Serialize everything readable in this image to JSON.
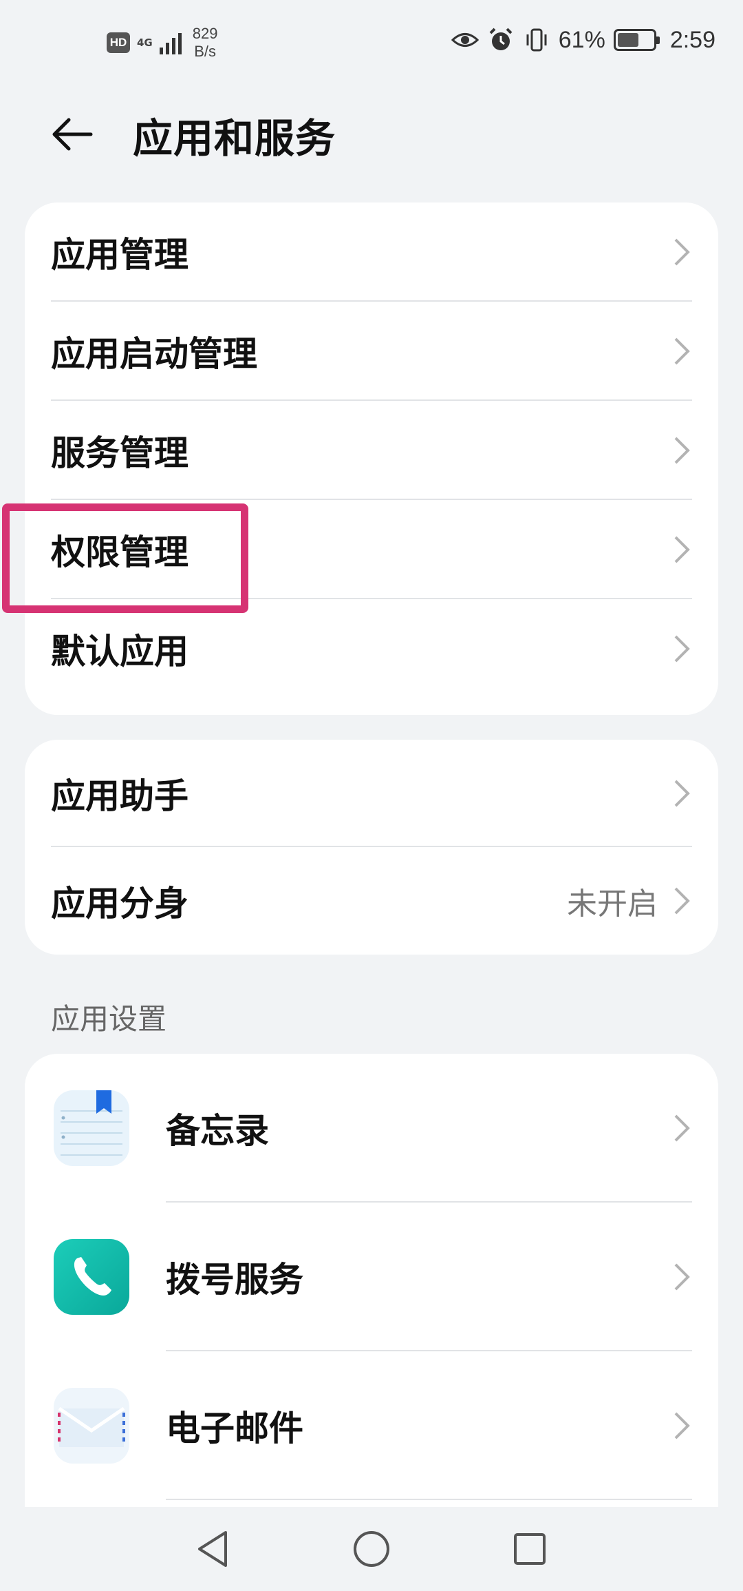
{
  "status_bar": {
    "hd": "HD",
    "network": "4G",
    "speed_value": "829",
    "speed_unit": "B/s",
    "battery": "61%",
    "time": "2:59",
    "battery_level": 0.61
  },
  "header": {
    "title": "应用和服务",
    "back_icon": "arrow-left-icon"
  },
  "group1": {
    "items": [
      {
        "label": "应用管理"
      },
      {
        "label": "应用启动管理"
      },
      {
        "label": "服务管理"
      },
      {
        "label": "权限管理"
      },
      {
        "label": "默认应用"
      }
    ]
  },
  "group2": {
    "items": [
      {
        "label": "应用助手",
        "value": ""
      },
      {
        "label": "应用分身",
        "value": "未开启"
      }
    ]
  },
  "app_settings": {
    "section_title": "应用设置",
    "items": [
      {
        "label": "备忘录",
        "icon": "notepad-icon"
      },
      {
        "label": "拨号服务",
        "icon": "phone-icon"
      },
      {
        "label": "电子邮件",
        "icon": "email-icon"
      }
    ]
  },
  "nav": {
    "back": "triangle-back-icon",
    "home": "circle-home-icon",
    "recents": "square-recents-icon"
  },
  "colors": {
    "highlight": "#d63373",
    "background": "#f1f3f5"
  }
}
